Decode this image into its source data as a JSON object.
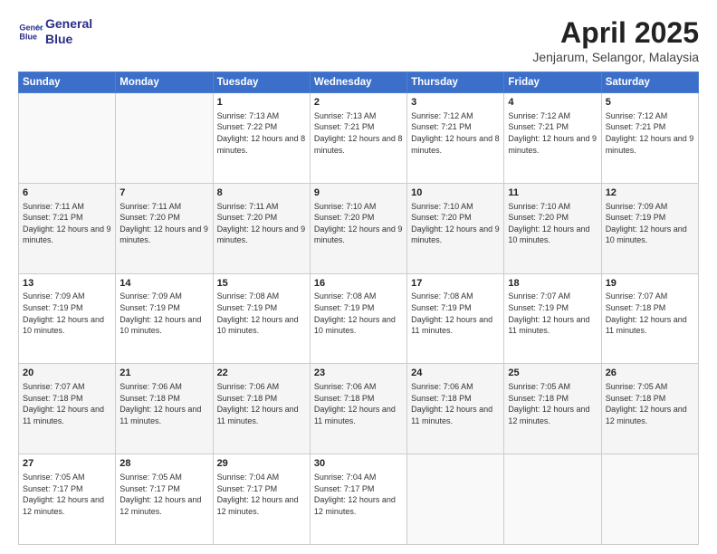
{
  "header": {
    "logo_line1": "General",
    "logo_line2": "Blue",
    "month_title": "April 2025",
    "location": "Jenjarum, Selangor, Malaysia"
  },
  "weekdays": [
    "Sunday",
    "Monday",
    "Tuesday",
    "Wednesday",
    "Thursday",
    "Friday",
    "Saturday"
  ],
  "weeks": [
    [
      {
        "day": "",
        "info": ""
      },
      {
        "day": "",
        "info": ""
      },
      {
        "day": "1",
        "info": "Sunrise: 7:13 AM\nSunset: 7:22 PM\nDaylight: 12 hours and 8 minutes."
      },
      {
        "day": "2",
        "info": "Sunrise: 7:13 AM\nSunset: 7:21 PM\nDaylight: 12 hours and 8 minutes."
      },
      {
        "day": "3",
        "info": "Sunrise: 7:12 AM\nSunset: 7:21 PM\nDaylight: 12 hours and 8 minutes."
      },
      {
        "day": "4",
        "info": "Sunrise: 7:12 AM\nSunset: 7:21 PM\nDaylight: 12 hours and 9 minutes."
      },
      {
        "day": "5",
        "info": "Sunrise: 7:12 AM\nSunset: 7:21 PM\nDaylight: 12 hours and 9 minutes."
      }
    ],
    [
      {
        "day": "6",
        "info": "Sunrise: 7:11 AM\nSunset: 7:21 PM\nDaylight: 12 hours and 9 minutes."
      },
      {
        "day": "7",
        "info": "Sunrise: 7:11 AM\nSunset: 7:20 PM\nDaylight: 12 hours and 9 minutes."
      },
      {
        "day": "8",
        "info": "Sunrise: 7:11 AM\nSunset: 7:20 PM\nDaylight: 12 hours and 9 minutes."
      },
      {
        "day": "9",
        "info": "Sunrise: 7:10 AM\nSunset: 7:20 PM\nDaylight: 12 hours and 9 minutes."
      },
      {
        "day": "10",
        "info": "Sunrise: 7:10 AM\nSunset: 7:20 PM\nDaylight: 12 hours and 9 minutes."
      },
      {
        "day": "11",
        "info": "Sunrise: 7:10 AM\nSunset: 7:20 PM\nDaylight: 12 hours and 10 minutes."
      },
      {
        "day": "12",
        "info": "Sunrise: 7:09 AM\nSunset: 7:19 PM\nDaylight: 12 hours and 10 minutes."
      }
    ],
    [
      {
        "day": "13",
        "info": "Sunrise: 7:09 AM\nSunset: 7:19 PM\nDaylight: 12 hours and 10 minutes."
      },
      {
        "day": "14",
        "info": "Sunrise: 7:09 AM\nSunset: 7:19 PM\nDaylight: 12 hours and 10 minutes."
      },
      {
        "day": "15",
        "info": "Sunrise: 7:08 AM\nSunset: 7:19 PM\nDaylight: 12 hours and 10 minutes."
      },
      {
        "day": "16",
        "info": "Sunrise: 7:08 AM\nSunset: 7:19 PM\nDaylight: 12 hours and 10 minutes."
      },
      {
        "day": "17",
        "info": "Sunrise: 7:08 AM\nSunset: 7:19 PM\nDaylight: 12 hours and 11 minutes."
      },
      {
        "day": "18",
        "info": "Sunrise: 7:07 AM\nSunset: 7:19 PM\nDaylight: 12 hours and 11 minutes."
      },
      {
        "day": "19",
        "info": "Sunrise: 7:07 AM\nSunset: 7:18 PM\nDaylight: 12 hours and 11 minutes."
      }
    ],
    [
      {
        "day": "20",
        "info": "Sunrise: 7:07 AM\nSunset: 7:18 PM\nDaylight: 12 hours and 11 minutes."
      },
      {
        "day": "21",
        "info": "Sunrise: 7:06 AM\nSunset: 7:18 PM\nDaylight: 12 hours and 11 minutes."
      },
      {
        "day": "22",
        "info": "Sunrise: 7:06 AM\nSunset: 7:18 PM\nDaylight: 12 hours and 11 minutes."
      },
      {
        "day": "23",
        "info": "Sunrise: 7:06 AM\nSunset: 7:18 PM\nDaylight: 12 hours and 11 minutes."
      },
      {
        "day": "24",
        "info": "Sunrise: 7:06 AM\nSunset: 7:18 PM\nDaylight: 12 hours and 11 minutes."
      },
      {
        "day": "25",
        "info": "Sunrise: 7:05 AM\nSunset: 7:18 PM\nDaylight: 12 hours and 12 minutes."
      },
      {
        "day": "26",
        "info": "Sunrise: 7:05 AM\nSunset: 7:18 PM\nDaylight: 12 hours and 12 minutes."
      }
    ],
    [
      {
        "day": "27",
        "info": "Sunrise: 7:05 AM\nSunset: 7:17 PM\nDaylight: 12 hours and 12 minutes."
      },
      {
        "day": "28",
        "info": "Sunrise: 7:05 AM\nSunset: 7:17 PM\nDaylight: 12 hours and 12 minutes."
      },
      {
        "day": "29",
        "info": "Sunrise: 7:04 AM\nSunset: 7:17 PM\nDaylight: 12 hours and 12 minutes."
      },
      {
        "day": "30",
        "info": "Sunrise: 7:04 AM\nSunset: 7:17 PM\nDaylight: 12 hours and 12 minutes."
      },
      {
        "day": "",
        "info": ""
      },
      {
        "day": "",
        "info": ""
      },
      {
        "day": "",
        "info": ""
      }
    ]
  ]
}
